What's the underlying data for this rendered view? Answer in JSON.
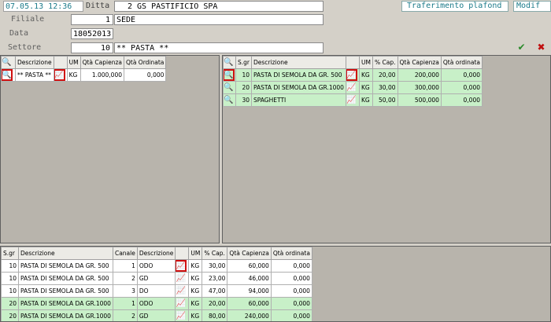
{
  "header": {
    "datetime": "07.05.13 12:36",
    "ditta_label": "Ditta",
    "ditta_value": "2 GS PASTIFICIO SPA",
    "filiale_label": "Filiale",
    "filiale_code": "1",
    "filiale_name": "SEDE",
    "data_label": "Data",
    "data_value": "18052013",
    "settore_label": "Settore",
    "settore_code": "10",
    "settore_name": "** PASTA **",
    "transfer_button": "Traferimento plafond",
    "modify_button": "Modif",
    "confirm_icon": "check-icon",
    "cancel_icon": "x-icon",
    "accent": "#1a7a8a"
  },
  "left_grid": {
    "headers": [
      "",
      "Descrizione",
      "",
      "UM",
      "Qtà Capienza",
      "Qtà Ordinata"
    ],
    "rows": [
      {
        "descr": "** PASTA **",
        "um": "KG",
        "cap": "1.000,000",
        "ord": "0,000"
      }
    ]
  },
  "right_grid": {
    "headers": [
      "",
      "S.gr",
      "Descrizione",
      "",
      "UM",
      "% Cap.",
      "Qtà Capienza",
      "Qtà ordinata"
    ],
    "rows": [
      {
        "sgr": "10",
        "descr": "PASTA DI SEMOLA DA GR. 500",
        "um": "KG",
        "pct": "20,00",
        "cap": "200,000",
        "ord": "0,000"
      },
      {
        "sgr": "20",
        "descr": "PASTA DI SEMOLA DA GR.1000",
        "um": "KG",
        "pct": "30,00",
        "cap": "300,000",
        "ord": "0,000"
      },
      {
        "sgr": "30",
        "descr": "SPAGHETTI",
        "um": "KG",
        "pct": "50,00",
        "cap": "500,000",
        "ord": "0,000"
      }
    ]
  },
  "bottom_grid": {
    "headers": [
      "S.gr",
      "Descrizione",
      "Canale",
      "Descrizione",
      "",
      "UM",
      "% Cap.",
      "Qtà Capienza",
      "Qtà ordinata"
    ],
    "rows": [
      {
        "sgr": "10",
        "descr": "PASTA DI SEMOLA DA GR. 500",
        "canale": "1",
        "cdescr": "ODO",
        "um": "KG",
        "pct": "30,00",
        "cap": "60,000",
        "ord": "0,000",
        "green": false
      },
      {
        "sgr": "10",
        "descr": "PASTA DI SEMOLA DA GR. 500",
        "canale": "2",
        "cdescr": "GD",
        "um": "KG",
        "pct": "23,00",
        "cap": "46,000",
        "ord": "0,000",
        "green": false
      },
      {
        "sgr": "10",
        "descr": "PASTA DI SEMOLA DA GR. 500",
        "canale": "3",
        "cdescr": "DO",
        "um": "KG",
        "pct": "47,00",
        "cap": "94,000",
        "ord": "0,000",
        "green": false
      },
      {
        "sgr": "20",
        "descr": "PASTA DI SEMOLA DA GR.1000",
        "canale": "1",
        "cdescr": "ODO",
        "um": "KG",
        "pct": "20,00",
        "cap": "60,000",
        "ord": "0,000",
        "green": true
      },
      {
        "sgr": "20",
        "descr": "PASTA DI SEMOLA DA GR.1000",
        "canale": "2",
        "cdescr": "GD",
        "um": "KG",
        "pct": "80,00",
        "cap": "240,000",
        "ord": "0,000",
        "green": true
      }
    ]
  }
}
